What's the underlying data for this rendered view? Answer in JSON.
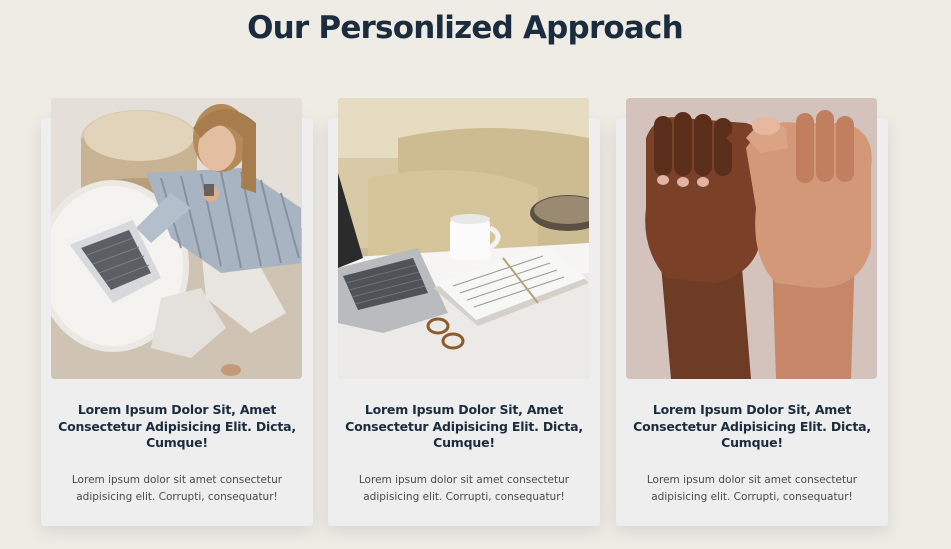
{
  "section": {
    "title": "Our Personlized Approach"
  },
  "cards": [
    {
      "image": "woman-with-laptop-photo",
      "heading": "Lorem Ipsum Dolor Sit, Amet Consectetur Adipisicing Elit. Dicta, Cumque!",
      "text": "Lorem ipsum dolor sit amet consectetur adipisicing elit. Corrupti, consequatur!"
    },
    {
      "image": "laptop-coffee-notebook-photo",
      "heading": "Lorem Ipsum Dolor Sit, Amet Consectetur Adipisicing Elit. Dicta, Cumque!",
      "text": "Lorem ipsum dolor sit amet consectetur adipisicing elit. Corrupti, consequatur!"
    },
    {
      "image": "pinky-promise-hands-photo",
      "heading": "Lorem Ipsum Dolor Sit, Amet Consectetur Adipisicing Elit. Dicta, Cumque!",
      "text": "Lorem ipsum dolor sit amet consectetur adipisicing elit. Corrupti, consequatur!"
    }
  ],
  "colors": {
    "background": "#efece6",
    "card": "#eeeeee",
    "heading": "#1b2c3e",
    "body_text": "#4a4a4a"
  }
}
